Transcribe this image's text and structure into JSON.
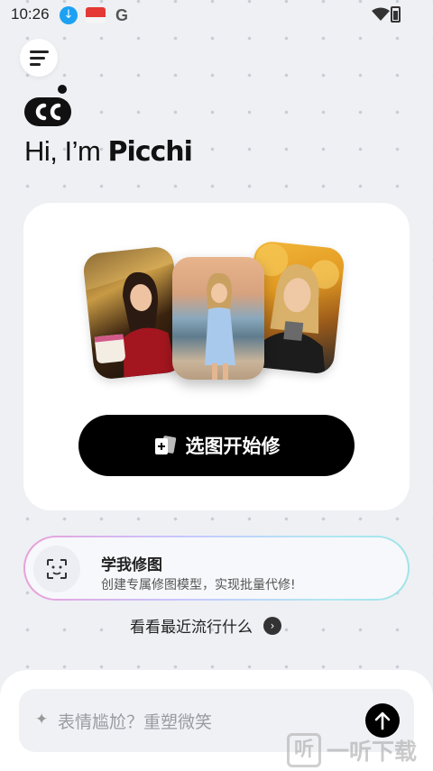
{
  "status_bar": {
    "time": "10:26",
    "icons": [
      "download-icon",
      "app-icon",
      "google-icon",
      "wifi-icon",
      "battery-icon"
    ]
  },
  "header": {
    "menu_icon": "hamburger-menu-icon",
    "logo_text": "CC",
    "greeting_prefix": "Hi, I’m",
    "brand_name": "Picchi"
  },
  "main_card": {
    "photos": [
      "birthday-photo",
      "beach-photo",
      "autumn-photo"
    ],
    "cta_label": "选图开始修",
    "cta_icon": "add-photo-icon"
  },
  "learn_card": {
    "icon": "face-scan-icon",
    "title": "学我修图",
    "subtitle": "创建专属修图模型，实现批量代修!"
  },
  "trending": {
    "label": "看看最近流行什么",
    "icon": "chevron-right-icon"
  },
  "prompt": {
    "icon": "sparkle-icon",
    "placeholder": "表情尴尬？重塑微笑",
    "send_icon": "arrow-up-icon"
  },
  "watermark": {
    "glyph": "听",
    "text": "一听下载"
  },
  "colors": {
    "background": "#eef0f4",
    "card": "#ffffff",
    "button": "#000000",
    "gradient_border": [
      "#e9a0d8",
      "#c8c6ff",
      "#a0e4e8"
    ]
  }
}
